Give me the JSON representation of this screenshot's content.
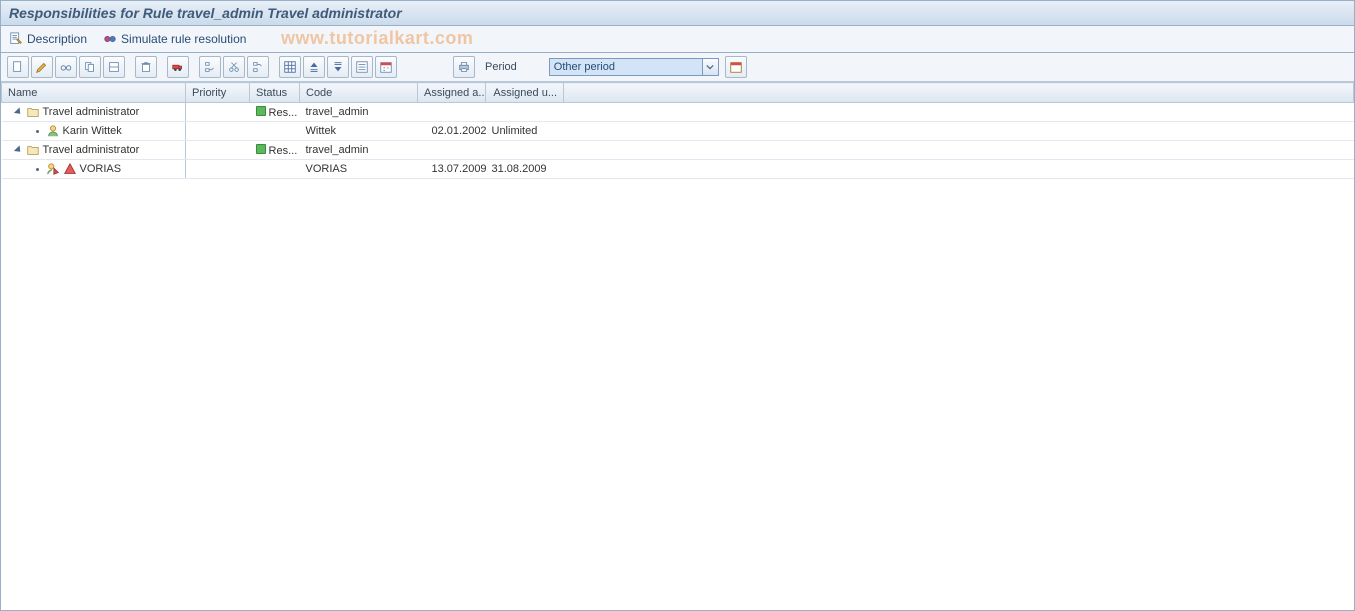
{
  "title": "Responsibilities for Rule travel_admin Travel administrator",
  "watermark": "www.tutorialkart.com",
  "subtoolbar": {
    "description": "Description",
    "simulate": "Simulate rule resolution"
  },
  "toolbar": {
    "period_label": "Period",
    "period_value": "Other period",
    "icons": [
      "doc",
      "edit",
      "display",
      "copy",
      "paste",
      "delete",
      "truck",
      "zoomin",
      "cut",
      "zoomout",
      "expand",
      "collapse",
      "layout",
      "selectall",
      "calendar",
      "print"
    ]
  },
  "columns": {
    "name": "Name",
    "priority": "Priority",
    "status": "Status",
    "code": "Code",
    "assigned_a": "Assigned a...",
    "assigned_u": "Assigned u..."
  },
  "rows": [
    {
      "level": 1,
      "icon": "folder",
      "name": "Travel administrator",
      "priority": "",
      "status": "green",
      "status_text": "Res...",
      "code": "travel_admin",
      "assigned_a": "",
      "assigned_u": ""
    },
    {
      "level": 2,
      "icon": "user",
      "name": "Karin Wittek",
      "priority": "",
      "status": "",
      "status_text": "",
      "code": "Wittek",
      "assigned_a": "02.01.2002",
      "assigned_u": "Unlimited"
    },
    {
      "level": 1,
      "icon": "folder",
      "name": "Travel administrator",
      "priority": "",
      "status": "green",
      "status_text": "Res...",
      "code": "travel_admin",
      "assigned_a": "",
      "assigned_u": ""
    },
    {
      "level": 2,
      "icon": "user-warn",
      "name": "VORIAS",
      "priority": "",
      "status": "",
      "status_text": "",
      "code": "VORIAS",
      "assigned_a": "13.07.2009",
      "assigned_u": "31.08.2009"
    }
  ]
}
